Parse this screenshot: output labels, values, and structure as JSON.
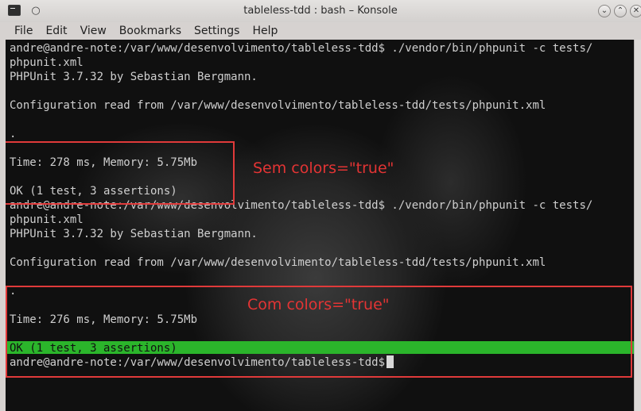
{
  "window": {
    "title": "tableless-tdd : bash – Konsole",
    "pin_glyph": "○",
    "min_glyph": "⌄",
    "max_glyph": "⌃",
    "close_glyph": "✕"
  },
  "menu": {
    "items": [
      "File",
      "Edit",
      "View",
      "Bookmarks",
      "Settings",
      "Help"
    ]
  },
  "terminal": {
    "lines": [
      "andre@andre-note:/var/www/desenvolvimento/tableless-tdd$ ./vendor/bin/phpunit -c tests/",
      "phpunit.xml",
      "PHPUnit 3.7.32 by Sebastian Bergmann.",
      "",
      "Configuration read from /var/www/desenvolvimento/tableless-tdd/tests/phpunit.xml",
      "",
      ".",
      "",
      "Time: 278 ms, Memory: 5.75Mb",
      "",
      "OK (1 test, 3 assertions)",
      "andre@andre-note:/var/www/desenvolvimento/tableless-tdd$ ./vendor/bin/phpunit -c tests/",
      "phpunit.xml",
      "PHPUnit 3.7.32 by Sebastian Bergmann.",
      "",
      "Configuration read from /var/www/desenvolvimento/tableless-tdd/tests/phpunit.xml",
      "",
      ".",
      "",
      "Time: 276 ms, Memory: 5.75Mb",
      "",
      "OK (1 test, 3 assertions)",
      "andre@andre-note:/var/www/desenvolvimento/tableless-tdd$"
    ]
  },
  "annotations": {
    "sem_label": "Sem colors=\"true\"",
    "com_label": "Com colors=\"true\""
  },
  "colors": {
    "ok_bar": "#2bb52b",
    "annotation": "#e03a3a",
    "terminal_text": "#cfcfcf"
  }
}
